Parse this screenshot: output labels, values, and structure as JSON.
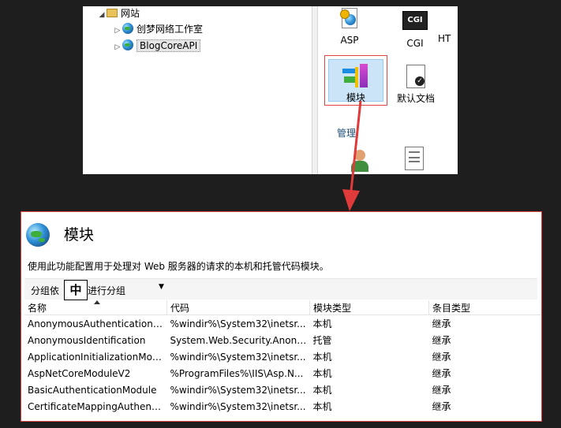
{
  "tree": {
    "sites_label": "网站",
    "sites": [
      {
        "label": "创梦网络工作室"
      },
      {
        "label": "BlogCoreAPI"
      }
    ]
  },
  "features": {
    "asp": "ASP",
    "cgi_icon_text": "CGI",
    "cgi": "CGI",
    "ht_partial": "HT",
    "modules": "模块",
    "default_doc": "默认文档",
    "manage_section": "管理"
  },
  "panel": {
    "title": "模块",
    "description": "使用此功能配置用于处理对 Web 服务器的请求的本机和托管代码模块。",
    "group_by_left": "分组依",
    "ime_char": "中",
    "group_by_right": "进行分组",
    "columns": [
      "名称",
      "代码",
      "模块类型",
      "条目类型"
    ],
    "rows": [
      [
        "AnonymousAuthenticationM...",
        "%windir%\\System32\\inetsr...",
        "本机",
        "继承"
      ],
      [
        "AnonymousIdentification",
        "System.Web.Security.Anony...",
        "托管",
        "继承"
      ],
      [
        "ApplicationInitializationMod...",
        "%windir%\\System32\\inetsr...",
        "本机",
        "继承"
      ],
      [
        "AspNetCoreModuleV2",
        "%ProgramFiles%\\IIS\\Asp.N...",
        "本机",
        "继承"
      ],
      [
        "BasicAuthenticationModule",
        "%windir%\\System32\\inetsr...",
        "本机",
        "继承"
      ],
      [
        "CertificateMappingAuthenti...",
        "%windir%\\System32\\inetsr...",
        "本机",
        "继承"
      ]
    ]
  },
  "colors": {
    "highlight_red": "#e04646",
    "selection_blue": "#cce4f7"
  },
  "icons": [
    "globe-icon",
    "folder-icon",
    "asp-icon",
    "cgi-icon",
    "modules-icon",
    "default-document-icon",
    "red-arrow-icon"
  ]
}
